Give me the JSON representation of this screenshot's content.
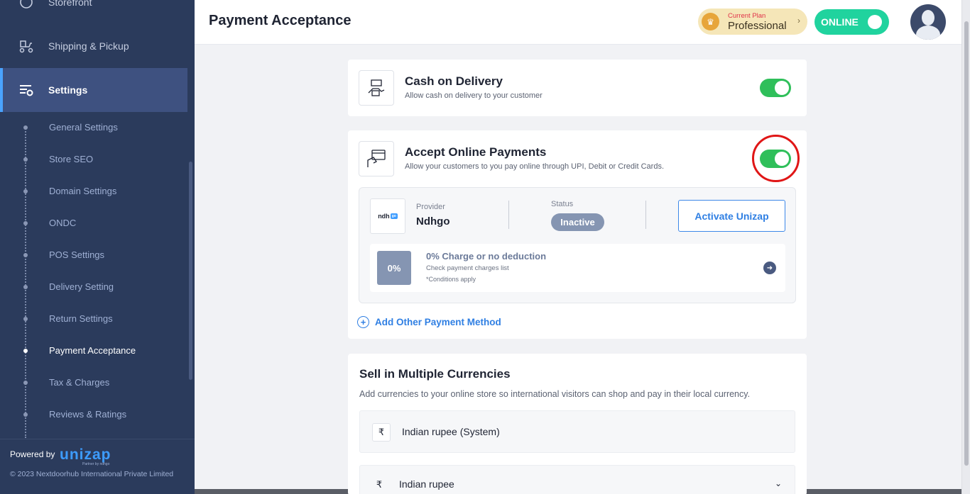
{
  "sidebar": {
    "nav": {
      "storefront": "Storefront",
      "shipping": "Shipping & Pickup",
      "settings": "Settings"
    },
    "sub_items": [
      {
        "label": "General Settings"
      },
      {
        "label": "Store SEO"
      },
      {
        "label": "Domain Settings"
      },
      {
        "label": "ONDC"
      },
      {
        "label": "POS Settings"
      },
      {
        "label": "Delivery Setting"
      },
      {
        "label": "Return Settings"
      },
      {
        "label": "Payment Acceptance"
      },
      {
        "label": "Tax & Charges"
      },
      {
        "label": "Reviews & Ratings"
      }
    ],
    "footer": {
      "powered_by": "Powered by",
      "brand": "unizap",
      "brand_sub": "Partner by ndhgo",
      "copyright": "© 2023 Nextdoorhub International Private Limited"
    }
  },
  "header": {
    "title": "Payment Acceptance",
    "plan_caption": "Current Plan",
    "plan_name": "Professional",
    "status_label": "ONLINE"
  },
  "cod": {
    "title": "Cash on Delivery",
    "subtitle": "Allow cash on delivery to your customer",
    "enabled": true
  },
  "online_payments": {
    "title": "Accept Online Payments",
    "subtitle": "Allow your customers to you pay online through UPI, Debit or Credit Cards.",
    "enabled": true,
    "provider_label": "Provider",
    "provider_name": "Ndhgo",
    "provider_logo_text": "ndh",
    "provider_logo_tag": "go",
    "status_label": "Status",
    "status_value": "Inactive",
    "activate_label": "Activate Unizap",
    "charge_badge": "0%",
    "charge_title": "0% Charge or no deduction",
    "charge_sub": "Check payment charges list",
    "charge_cond": "*Conditions apply",
    "add_method_label": "Add Other Payment Method"
  },
  "currencies": {
    "title": "Sell in Multiple Currencies",
    "subtitle": "Add currencies to your online store so international visitors can shop and pay in their local currency.",
    "rows": [
      {
        "symbol": "₹",
        "name": "Indian rupee (System)"
      },
      {
        "symbol": "₹",
        "name": "Indian rupee"
      }
    ]
  },
  "colors": {
    "sidebar_bg": "#2b3b5c",
    "accent": "#2f7fe3",
    "toggle_on": "#2fbf5a",
    "online_badge": "#20d39e",
    "highlight": "#e01616"
  }
}
